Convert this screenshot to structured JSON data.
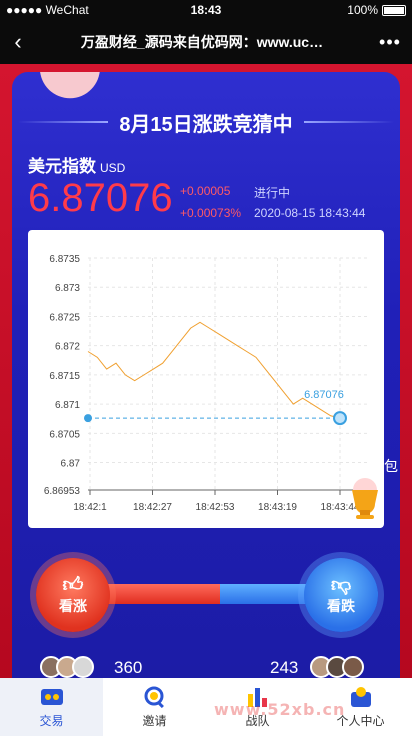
{
  "status_bar": {
    "carrier": "●●●●● WeChat",
    "time": "18:43",
    "battery": "100%"
  },
  "nav": {
    "title": "万盈财经_源码来自优码网：www.uc…",
    "more": "•••"
  },
  "banner": {
    "title": "8月15日涨跌竞猜中"
  },
  "index": {
    "name": "美元指数",
    "unit": "USD",
    "price": "6.87076",
    "change": "+0.00005",
    "change_pct": "+0.00073%",
    "status": "进行中",
    "timestamp": "2020-08-15 18:43:44"
  },
  "chart_data": {
    "type": "line",
    "x_ticks": [
      "18:42:1",
      "18:42:27",
      "18:42:53",
      "18:43:19",
      "18:43:44"
    ],
    "y_ticks": [
      "6.8735",
      "6.873",
      "6.8725",
      "6.872",
      "6.8715",
      "6.871",
      "6.8705",
      "6.87",
      "6.86953"
    ],
    "ylim": [
      6.86953,
      6.8735
    ],
    "reference_value": 6.87076,
    "current_label": "6.87076",
    "series": [
      {
        "values": [
          6.8719,
          6.8718,
          6.8716,
          6.8717,
          6.8715,
          6.8714,
          6.8715,
          6.8716,
          6.8717,
          6.8719,
          6.8721,
          6.8723,
          6.8724,
          6.8723,
          6.8722,
          6.8721,
          6.872,
          6.8719,
          6.8718,
          6.8716,
          6.8714,
          6.8712,
          6.871,
          6.8711,
          6.871,
          6.8709,
          6.8708,
          6.87076
        ]
      }
    ]
  },
  "side_label": "包",
  "actions": {
    "up_label": "看涨",
    "down_label": "看跌",
    "up_count": "360",
    "down_count": "243"
  },
  "tabs": [
    {
      "label": "交易",
      "icon": "trade-icon"
    },
    {
      "label": "邀请",
      "icon": "invite-icon"
    },
    {
      "label": "战队",
      "icon": "team-icon"
    },
    {
      "label": "个人中心",
      "icon": "profile-icon"
    }
  ],
  "watermark": "www.52xb.cn"
}
